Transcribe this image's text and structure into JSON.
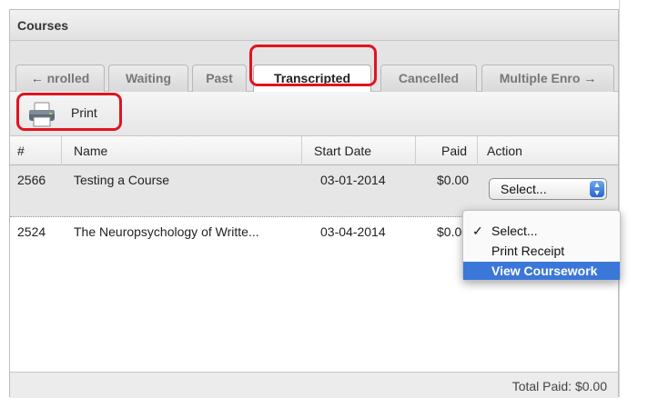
{
  "panel": {
    "title": "Courses"
  },
  "tabs": {
    "left_arrow": "←",
    "right_arrow": "→",
    "items": [
      {
        "label": "nrolled"
      },
      {
        "label": "Waiting"
      },
      {
        "label": "Past"
      },
      {
        "label": "Transcripted"
      },
      {
        "label": "Cancelled"
      },
      {
        "label": "Multiple Enro"
      }
    ],
    "active": "Transcripted"
  },
  "toolbar": {
    "print_label": "Print"
  },
  "table": {
    "columns": [
      "#",
      "Name",
      "Start Date",
      "Paid",
      "Action"
    ],
    "rows": [
      {
        "id": "2566",
        "name": "Testing a Course",
        "start_date": "03-01-2014",
        "paid": "$0.00",
        "action": "Select..."
      },
      {
        "id": "2524",
        "name": "The Neuropsychology of Writte...",
        "start_date": "03-04-2014",
        "paid": "$0.00",
        "action": "Select..."
      }
    ]
  },
  "dropdown": {
    "checkmark": "✓",
    "options": [
      "Select...",
      "Print Receipt",
      "View Coursework"
    ],
    "selected": "Select...",
    "highlighted": "View Coursework"
  },
  "footer": {
    "total_label": "Total Paid: $0.00"
  },
  "colors": {
    "highlight_ring": "#e0141e",
    "menu_hover": "#3b77d9",
    "stepper": "#2566d3"
  }
}
